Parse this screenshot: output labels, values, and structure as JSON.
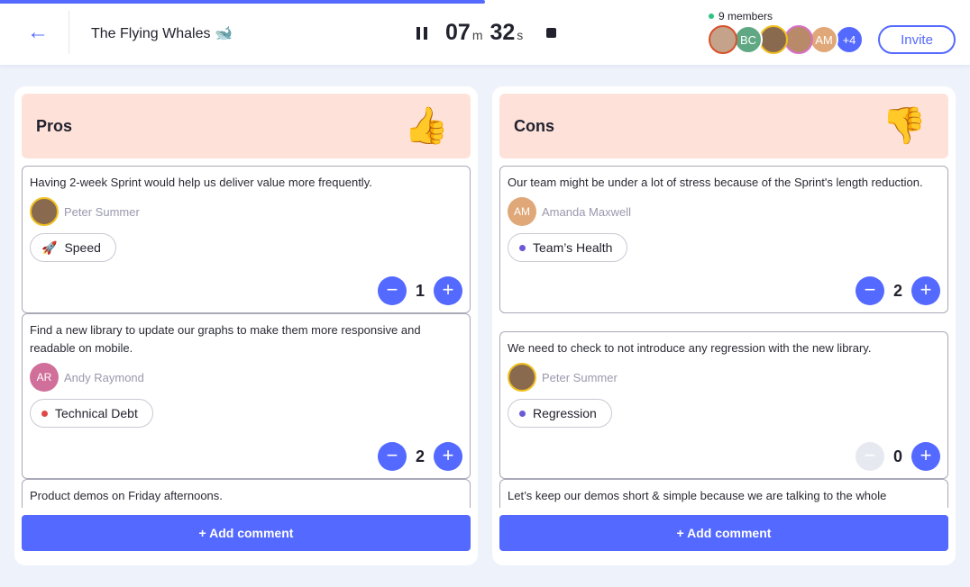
{
  "session": {
    "title": "The Flying Whales 🐋",
    "progress_percent": 50,
    "timer": {
      "minutes": "07",
      "m": "m",
      "seconds": "32",
      "s": "s"
    }
  },
  "members": {
    "label": "9 members",
    "avatars": [
      {
        "initials": "",
        "color": "#c4a38a",
        "ring": "#d9502a"
      },
      {
        "initials": "BC",
        "color": "#5fa883",
        "ring": "#fff"
      },
      {
        "initials": "",
        "color": "#8a6a4f",
        "ring": "#f0c020"
      },
      {
        "initials": "",
        "color": "#b88a6a",
        "ring": "#d870c8"
      },
      {
        "initials": "AM",
        "color": "#e0a878",
        "ring": "#fff"
      },
      {
        "initials": "+4",
        "color": "#5469ff",
        "ring": "#fff"
      }
    ],
    "invite_label": "Invite"
  },
  "columns": [
    {
      "title": "Pros",
      "emoji": "👍",
      "add_label": "+ Add comment",
      "cards": [
        {
          "text": "Having 2-week Sprint would help us deliver value more frequently.",
          "author": "Peter Summer",
          "initials": "",
          "avatar_color": "#8a6a4f",
          "tag": "Speed",
          "tag_icon": "rocket-icon",
          "tag_color": "",
          "votes": "1",
          "minus_disabled": false
        },
        {
          "text": "Find a new library to update our graphs to make them more responsive and readable on mobile.",
          "author": "Andy Raymond",
          "initials": "AR",
          "avatar_color": "#d0709a",
          "tag": "Technical Debt",
          "tag_color": "#e04848",
          "votes": "2",
          "minus_disabled": false
        },
        {
          "text": "Product demos on Friday afternoons."
        }
      ]
    },
    {
      "title": "Cons",
      "emoji": "👎",
      "add_label": "+ Add comment",
      "cards": [
        {
          "text": "Our team might be under a lot of stress because of the Sprint's length reduction.",
          "author": "Amanda Maxwell",
          "initials": "AM",
          "avatar_color": "#e0a878",
          "tag": "Team’s Health",
          "tag_color": "#6a5ad8",
          "votes": "2",
          "minus_disabled": false
        },
        {
          "text": "We need to check to not introduce any regression with the new library.",
          "author": "Peter Summer",
          "initials": "",
          "avatar_color": "#8a6a4f",
          "tag": "Regression",
          "tag_color": "#6a5ad8",
          "votes": "0",
          "minus_disabled": true
        },
        {
          "text": "Let’s keep our demos short & simple because we are talking to the whole"
        }
      ]
    }
  ]
}
